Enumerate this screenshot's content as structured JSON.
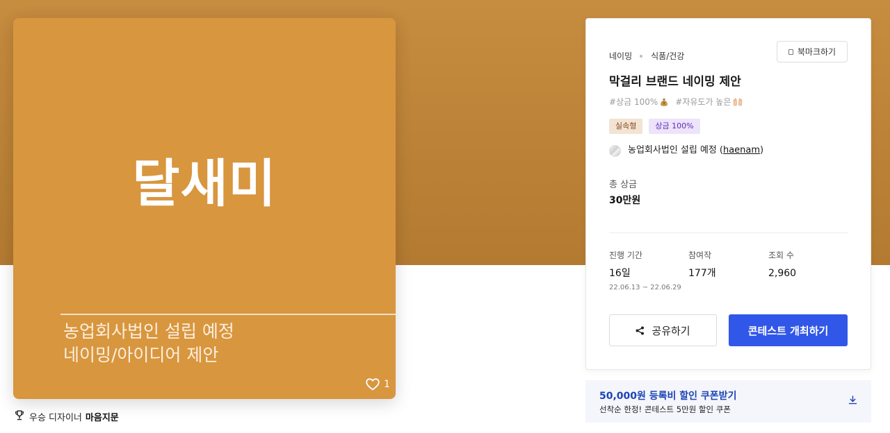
{
  "colors": {
    "hero_top": "#C68C3F",
    "hero_bottom": "#B37A31",
    "thumbnail_bg": "#D8963F",
    "primary_button": "#3157E8",
    "coupon_bg": "#F4F6FB",
    "coupon_text": "#1E43B5"
  },
  "thumbnail": {
    "brand_name": "달새미",
    "caption_lines": [
      "농업회사법인 설립 예정",
      "네이밍/아이디어 제안"
    ],
    "like_icon": "heart-outline-icon",
    "like_count": "1"
  },
  "winner": {
    "icon": "trophy-icon",
    "label": "우승 디자이너",
    "designer_name": "마음지문"
  },
  "contest": {
    "breadcrumb": [
      "네이밍",
      "식품/건강"
    ],
    "bookmark": {
      "icon": "bookmark-icon",
      "label": "북마크하기"
    },
    "title": "막걸리 브랜드 네이밍 제안",
    "hashtags": [
      {
        "text": "#상금 100%",
        "icon": "money-bag-icon"
      },
      {
        "text": "#자유도가 높은",
        "icon": "raising-hands-icon"
      }
    ],
    "badges": [
      {
        "label": "실속형",
        "bg": "#F3E3D3",
        "color": "#7F4A1E"
      },
      {
        "label": "상금 100%",
        "bg": "#EDE3FA",
        "color": "#5B2DB3"
      }
    ],
    "client": {
      "avatar_icon": "client-avatar-icon",
      "name": "농업회사법인 설립 예정",
      "paren_open": "(",
      "username": "haenam",
      "paren_close": ")"
    },
    "prize": {
      "label": "총 상금",
      "value": "30만원"
    },
    "stats": {
      "period": {
        "label": "진행 기간",
        "value": "16일",
        "dates": "22.06.13 ~ 22.06.29"
      },
      "entries": {
        "label": "참여작",
        "value": "177개"
      },
      "views": {
        "label": "조회 수",
        "value": "2,960"
      }
    },
    "share": {
      "icon": "share-icon",
      "label": "공유하기"
    },
    "host_button": "콘테스트 개최하기"
  },
  "coupon": {
    "title": "50,000원 등록비 할인 쿠폰받기",
    "subtitle": "선착순 한정! 콘테스트 5만원 할인 쿠폰",
    "icon": "download-icon"
  }
}
